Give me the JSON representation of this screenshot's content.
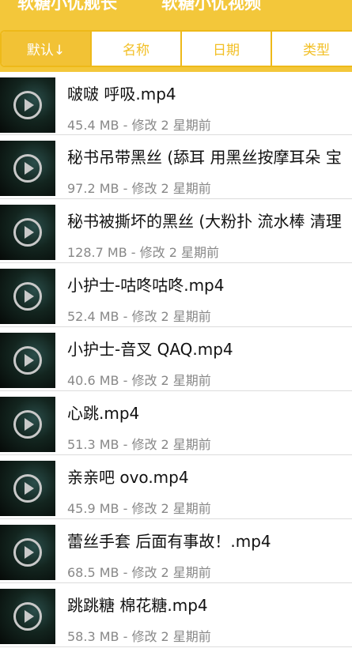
{
  "header": {
    "title_left": "软糖小优舰长",
    "title_right": "软糖小优视频"
  },
  "sort_tabs": [
    {
      "label": "默认↓",
      "active": true
    },
    {
      "label": "名称",
      "active": false
    },
    {
      "label": "日期",
      "active": false
    },
    {
      "label": "类型",
      "active": false
    }
  ],
  "files": [
    {
      "name": "啵啵 呼吸.mp4",
      "meta": "45.4 MB - 修改 2 星期前"
    },
    {
      "name": "秘书吊带黑丝 (舔耳 用黑丝按摩耳朵 宝",
      "meta": "97.2 MB - 修改 2 星期前"
    },
    {
      "name": "秘书被撕坏的黑丝 (大粉扑 流水棒 清理",
      "meta": "128.7 MB - 修改 2 星期前"
    },
    {
      "name": "小护士-咕咚咕咚.mp4",
      "meta": "52.4 MB - 修改 2 星期前"
    },
    {
      "name": "小护士-音叉 QAQ.mp4",
      "meta": "40.6 MB - 修改 2 星期前"
    },
    {
      "name": "心跳.mp4",
      "meta": "51.3 MB - 修改 2 星期前"
    },
    {
      "name": "亲亲吧 ovo.mp4",
      "meta": "45.9 MB - 修改 2 星期前"
    },
    {
      "name": "蕾丝手套 后面有事故！.mp4",
      "meta": "68.5 MB - 修改 2 星期前"
    },
    {
      "name": "跳跳糖 棉花糖.mp4",
      "meta": "58.3 MB - 修改 2 星期前"
    }
  ]
}
